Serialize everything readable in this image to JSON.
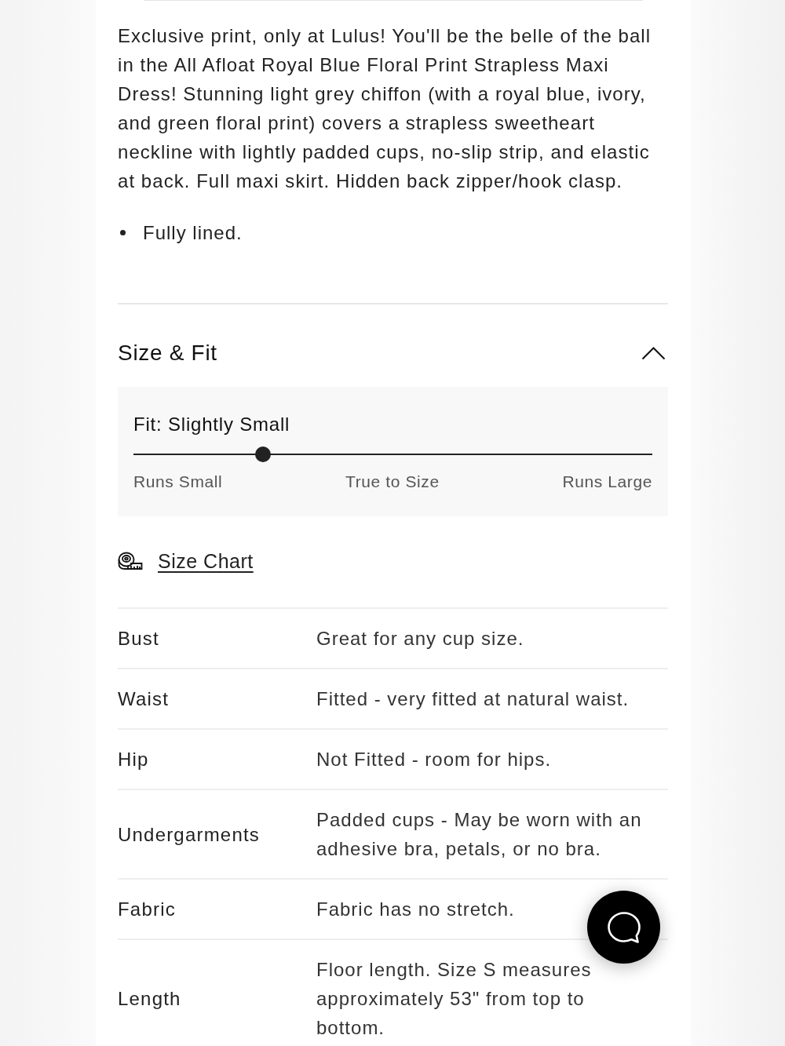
{
  "description": {
    "text": "Exclusive print, only at Lulus! You'll be the belle of the ball in the All Afloat Royal Blue Floral Print Strapless Maxi Dress! Stunning light grey chiffon (with a royal blue, ivory, and green floral print) covers a strapless sweetheart neckline with lightly padded cups, no-slip strip, and elastic at back. Full maxi skirt. Hidden back zipper/hook clasp.",
    "bullets": [
      "Fully lined."
    ]
  },
  "size_fit": {
    "title": "Size & Fit",
    "expanded": true,
    "fit_label": "Fit: Slightly Small",
    "fit_scale": {
      "level": 0.25,
      "labels": [
        "Runs Small",
        "True to Size",
        "Runs Large"
      ]
    },
    "size_chart_link": "Size Chart",
    "rows": [
      {
        "label": "Bust",
        "value": "Great for any cup size."
      },
      {
        "label": "Waist",
        "value": "Fitted - very fitted at natural waist."
      },
      {
        "label": "Hip",
        "value": "Not Fitted - room for hips."
      },
      {
        "label": "Undergarments",
        "value": "Padded cups - May be worn with an adhesive bra, petals, or no bra."
      },
      {
        "label": "Fabric",
        "value": "Fabric has no stretch."
      },
      {
        "label": "Length",
        "value": "Floor length. Size S measures approximately 53\" from top to bottom."
      }
    ]
  }
}
